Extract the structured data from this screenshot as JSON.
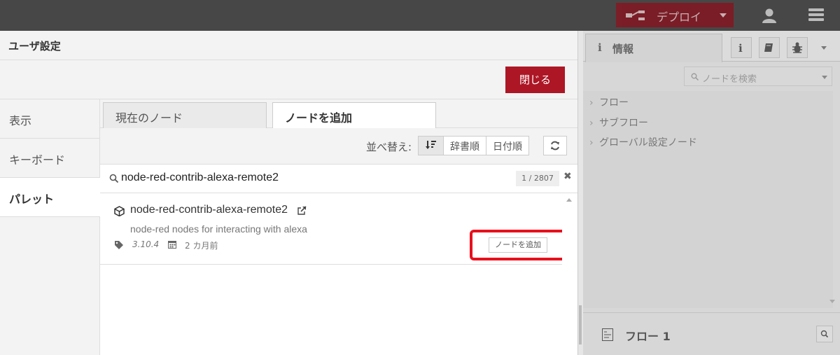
{
  "header": {
    "deploy_label": "デプロイ"
  },
  "dialog": {
    "title": "ユーザ設定",
    "close_label": "閉じる",
    "side_tabs": [
      {
        "label": "表示"
      },
      {
        "label": "キーボード"
      },
      {
        "label": "パレット"
      }
    ],
    "palette_tabs": [
      {
        "label": "現在のノード"
      },
      {
        "label": "ノードを追加"
      }
    ],
    "sort": {
      "label": "並べ替え:",
      "options": [
        "辞書順",
        "日付順"
      ]
    },
    "search": {
      "value": "node-red-contrib-alexa-remote2",
      "count": "1 / 2807"
    },
    "result": {
      "name": "node-red-contrib-alexa-remote2",
      "description": "node-red nodes for interacting with alexa",
      "version": "3.10.4",
      "updated": "2 カ月前",
      "add_label": "ノードを追加"
    }
  },
  "sidebar": {
    "info_tab_label": "情報",
    "search_placeholder": "ノードを検索",
    "tree": [
      "フロー",
      "サブフロー",
      "グローバル設定ノード"
    ],
    "bottom_label": "フロー 1"
  },
  "colors": {
    "header_bg": "#474747",
    "accent_red": "#ad1625",
    "highlight_red": "#e8101d"
  }
}
